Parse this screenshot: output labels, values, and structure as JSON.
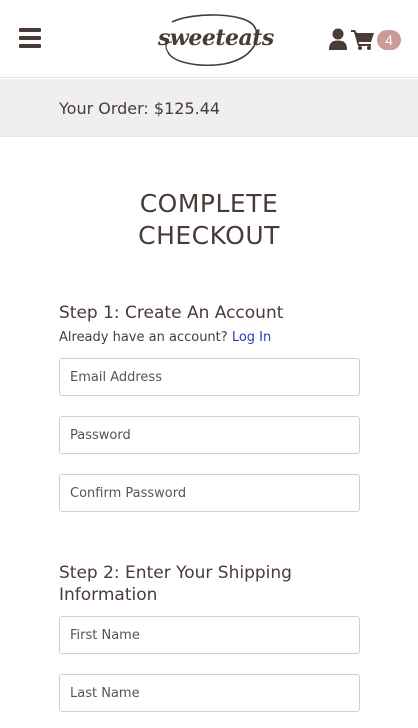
{
  "header": {
    "logo_text": "sweeteats",
    "cart_count": "4",
    "icons": {
      "menu": "hamburger-menu-icon",
      "user": "user-icon",
      "cart": "shopping-cart-icon"
    }
  },
  "order_bar": {
    "text": "Your Order: $125.44"
  },
  "page": {
    "title_line1": "COMPLETE",
    "title_line2": "CHECKOUT"
  },
  "step1": {
    "title": "Step 1: Create An Account",
    "login_prompt": "Already have an account?",
    "login_link": "Log In",
    "fields": {
      "email_placeholder": "Email Address",
      "password_placeholder": "Password",
      "confirm_password_placeholder": "Confirm Password"
    }
  },
  "step2": {
    "title": "Step 2: Enter Your Shipping Information",
    "fields": {
      "first_name_placeholder": "First Name",
      "last_name_placeholder": "Last Name"
    }
  },
  "colors": {
    "text": "#4a3b38",
    "badge": "#c99a97",
    "link": "#2b3fb8",
    "order_bar_bg": "#efefef"
  }
}
